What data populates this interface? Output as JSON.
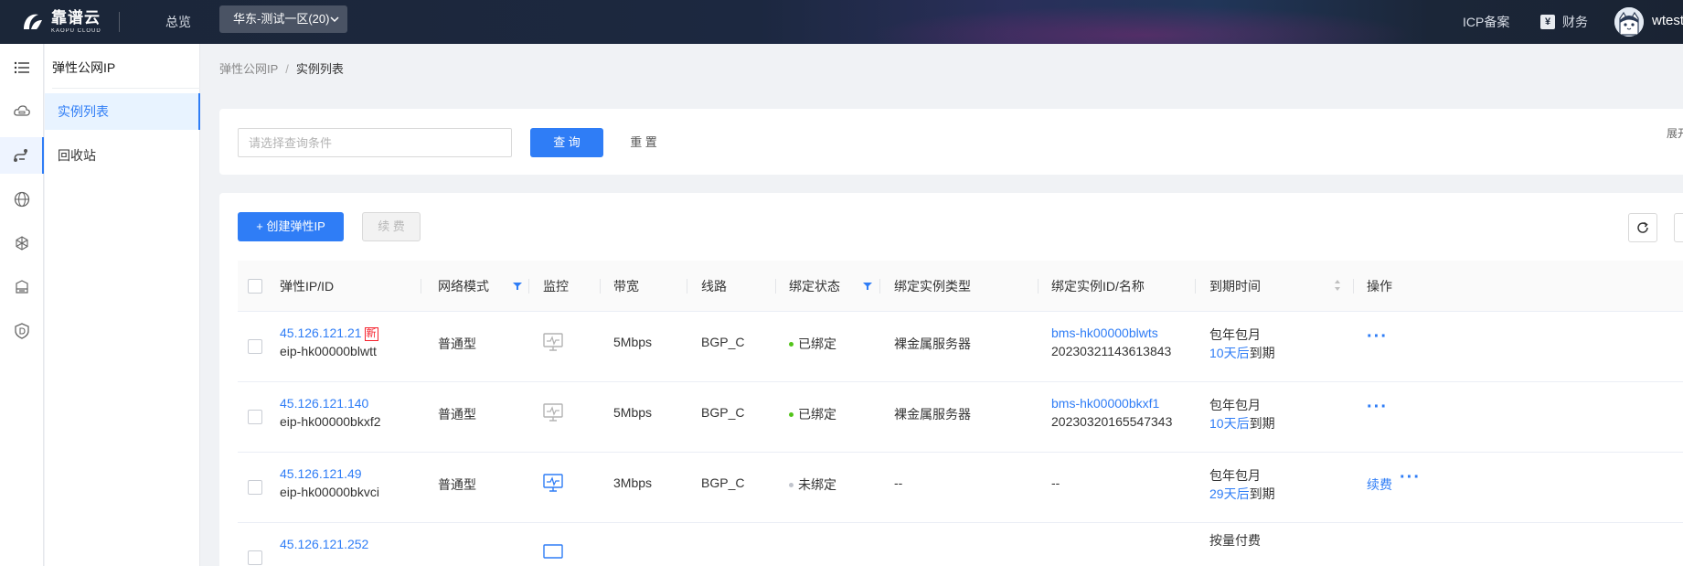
{
  "header": {
    "logo_cn": "靠谱云",
    "logo_en": "KAOPU CLOUD",
    "overview": "总览",
    "region": "华东-测试一区(20)",
    "icp": "ICP备案",
    "finance_icon": "¥",
    "finance": "财务",
    "username": "wtest"
  },
  "rail": {
    "icons": [
      "list-icon",
      "cloud-server-icon",
      "elastic-ip-icon",
      "globe-icon",
      "network-icon",
      "storage-icon",
      "security-shield-icon"
    ]
  },
  "sidebar": {
    "title": "弹性公网IP",
    "items": [
      {
        "label": "实例列表"
      },
      {
        "label": "回收站"
      }
    ]
  },
  "breadcrumb": {
    "parent": "弹性公网IP",
    "separator": "/",
    "current": "实例列表"
  },
  "filter": {
    "placeholder": "请选择查询条件",
    "query": "查 询",
    "reset": "重 置",
    "expand": "展开"
  },
  "toolbar": {
    "create": "+ 创建弹性IP",
    "renew": "续 费"
  },
  "table": {
    "columns": [
      "弹性IP/ID",
      "网络模式",
      "监控",
      "带宽",
      "线路",
      "绑定状态",
      "绑定实例类型",
      "绑定实例ID/名称",
      "到期时间",
      "操作"
    ],
    "rows": [
      {
        "ip": "45.126.121.21",
        "badge": "新",
        "id": "eip-hk00000blwtt",
        "mode": "普通型",
        "bandwidth": "5Mbps",
        "line": "BGP_C",
        "status": "已绑定",
        "instance_type": "裸金属服务器",
        "instance_id": "bms-hk00000blwts",
        "instance_name": "20230321143613843",
        "billing": "包年包月",
        "expire_days": "10天后",
        "expire_suffix": "到期",
        "renew": "",
        "more": "···"
      },
      {
        "ip": "45.126.121.140",
        "badge": "",
        "id": "eip-hk00000bkxf2",
        "mode": "普通型",
        "bandwidth": "5Mbps",
        "line": "BGP_C",
        "status": "已绑定",
        "instance_type": "裸金属服务器",
        "instance_id": "bms-hk00000bkxf1",
        "instance_name": "20230320165547343",
        "billing": "包年包月",
        "expire_days": "10天后",
        "expire_suffix": "到期",
        "renew": "",
        "more": "···"
      },
      {
        "ip": "45.126.121.49",
        "badge": "",
        "id": "eip-hk00000bkvci",
        "mode": "普通型",
        "bandwidth": "3Mbps",
        "line": "BGP_C",
        "status": "未绑定",
        "instance_type": "--",
        "instance_id": "--",
        "instance_name": "",
        "billing": "包年包月",
        "expire_days": "29天后",
        "expire_suffix": "到期",
        "renew": "续费",
        "more": "···"
      },
      {
        "ip": "45.126.121.252",
        "badge": "",
        "id": "",
        "mode": "",
        "bandwidth": "",
        "line": "",
        "status": "",
        "instance_type": "",
        "instance_id": "",
        "instance_name": "",
        "billing": "按量付费",
        "expire_days": "",
        "expire_suffix": "",
        "renew": "",
        "more": ""
      }
    ]
  },
  "colors": {
    "primary": "#2f7df6",
    "bound_dot": "#52c41a",
    "unbound_dot": "#c0c4cc",
    "badge": "#f5222d"
  }
}
